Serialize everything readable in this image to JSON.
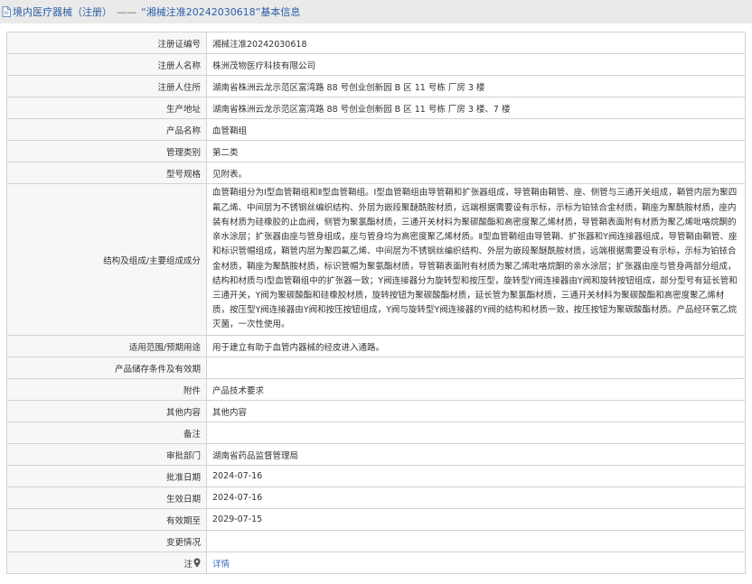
{
  "header": {
    "title": "境内医疗器械（注册）",
    "separator": "——",
    "subtitle": "“湘械注准20242030618”基本信息"
  },
  "rows": [
    {
      "label": "注册证编号",
      "value": "湘械注准20242030618"
    },
    {
      "label": "注册人名称",
      "value": "株洲茂物医疗科技有限公司"
    },
    {
      "label": "注册人住所",
      "value": "湖南省株洲云龙示范区富湾路 88 号创业创新园 B 区 11 号栋 厂房 3 楼"
    },
    {
      "label": "生产地址",
      "value": "湖南省株洲云龙示范区富湾路 88 号创业创新园 B 区 11 号栋 厂房 3 楼、7 楼"
    },
    {
      "label": "产品名称",
      "value": "血管鞘组"
    },
    {
      "label": "管理类别",
      "value": "第二类"
    },
    {
      "label": "型号规格",
      "value": "见附表。"
    },
    {
      "label": "结构及组成/主要组成成分",
      "value": "血管鞘组分为Ⅰ型血管鞘组和Ⅱ型血管鞘组。Ⅰ型血管鞘组由导管鞘和扩张器组成，导管鞘由鞘管、座、侧管与三通开关组成，鞘管内层为聚四氟乙烯、中间层为不锈钢丝编织结构、外层为嵌段聚醚酰胺材质，远端根据需要设有示标，示标为铂铱合金材质，鞘座为聚酰胺材质，座内装有材质为硅橡胶的止血阀，侧管为聚氯酯材质，三通开关材料为聚碳酸酯和高密度聚乙烯材质，导管鞘表面附有材质为聚乙烯吡咯烷酮的亲水涂层；扩张器由座与管身组成，座与管身均为高密度聚乙烯材质。Ⅱ型血管鞘组由导管鞘、扩张器和Y阀连接器组成，导管鞘由鞘管、座和标识管帽组成，鞘管内层为聚四氟乙烯、中间层为不锈钢丝编织结构、外层为嵌段聚醚酰胺材质，远端根据需要设有示标，示标为铂铱合金材质，鞘座为聚酰胺材质，标识管帽为聚氨酯材质，导管鞘表面附有材质为聚乙烯吡咯烷酮的亲水涂层；扩张器由座与管身两部分组成，结构和材质与Ⅰ型血管鞘组中的扩张器一致；Y阀连接器分为旋转型和按压型，旋转型Y阀连接器由Y阀和旋转按钮组成，部分型号有延长管和三通开关，Y阀为聚碳酸酯和硅橡胶材质，旋转按钮为聚碳酸酯材质，延长管为聚氯酯材质，三通开关材料为聚碳酸酯和高密度聚乙烯材质，按压型Y阀连接器由Y阀和按压按钮组成，Y阀与旋转型Y阀连接器的Y阀的结构和材质一致，按压按钮为聚碳酸酯材质。产品经环氧乙烷灭菌，一次性使用。"
    },
    {
      "label": "适用范围/预期用途",
      "value": "用于建立有助于血管内器械的经皮进入通路。"
    },
    {
      "label": "产品储存条件及有效期",
      "value": ""
    },
    {
      "label": "附件",
      "value": "产品技术要求"
    },
    {
      "label": "其他内容",
      "value": "其他内容"
    },
    {
      "label": "备注",
      "value": ""
    },
    {
      "label": "审批部门",
      "value": "湖南省药品监督管理局"
    },
    {
      "label": "批准日期",
      "value": "2024-07-16"
    },
    {
      "label": "生效日期",
      "value": "2024-07-16"
    },
    {
      "label": "有效期至",
      "value": "2029-07-15"
    },
    {
      "label": "变更情况",
      "value": ""
    }
  ],
  "footer_row": {
    "label": "注",
    "icon": "location-pin-icon",
    "link": "详情"
  },
  "colors": {
    "header_bg": "#eaeaea",
    "title_blue": "#2a5ea8",
    "link_blue": "#3b6cc2",
    "border": "#d2d2d2"
  }
}
